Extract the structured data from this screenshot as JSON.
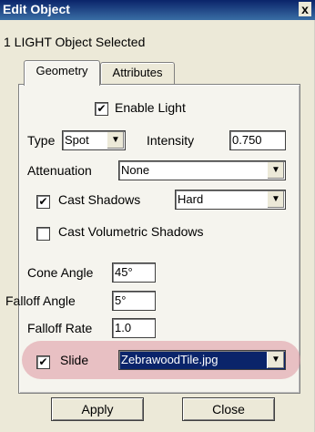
{
  "window": {
    "title": "Edit Object",
    "close_glyph": "x"
  },
  "subtitle": "1 LIGHT Object Selected",
  "tabs": [
    {
      "label": "Geometry",
      "active": true
    },
    {
      "label": "Attributes",
      "active": false
    }
  ],
  "form": {
    "enable_light": {
      "label": "Enable Light",
      "checked": true
    },
    "type": {
      "label": "Type",
      "value": "Spot"
    },
    "intensity": {
      "label": "Intensity",
      "value": "0.750"
    },
    "attenuation": {
      "label": "Attenuation",
      "value": "None"
    },
    "cast_shadows": {
      "label": "Cast Shadows",
      "checked": true,
      "value": "Hard"
    },
    "cast_volumetric_shadows": {
      "label": "Cast Volumetric Shadows",
      "checked": false
    },
    "cone_angle": {
      "label": "Cone Angle",
      "value": "45°"
    },
    "falloff_angle": {
      "label": "Falloff Angle",
      "value": "5°"
    },
    "falloff_rate": {
      "label": "Falloff Rate",
      "value": "1.0"
    },
    "slide": {
      "label": "Slide",
      "checked": true,
      "value": "ZebrawoodTile.jpg"
    }
  },
  "buttons": {
    "apply": "Apply",
    "close": "Close"
  },
  "check_glyph": "✔",
  "dropdown_glyph": "▼",
  "colors": {
    "titlebar": "#0a246a",
    "selection": "#0a246a",
    "highlight": "#dc96a0"
  }
}
